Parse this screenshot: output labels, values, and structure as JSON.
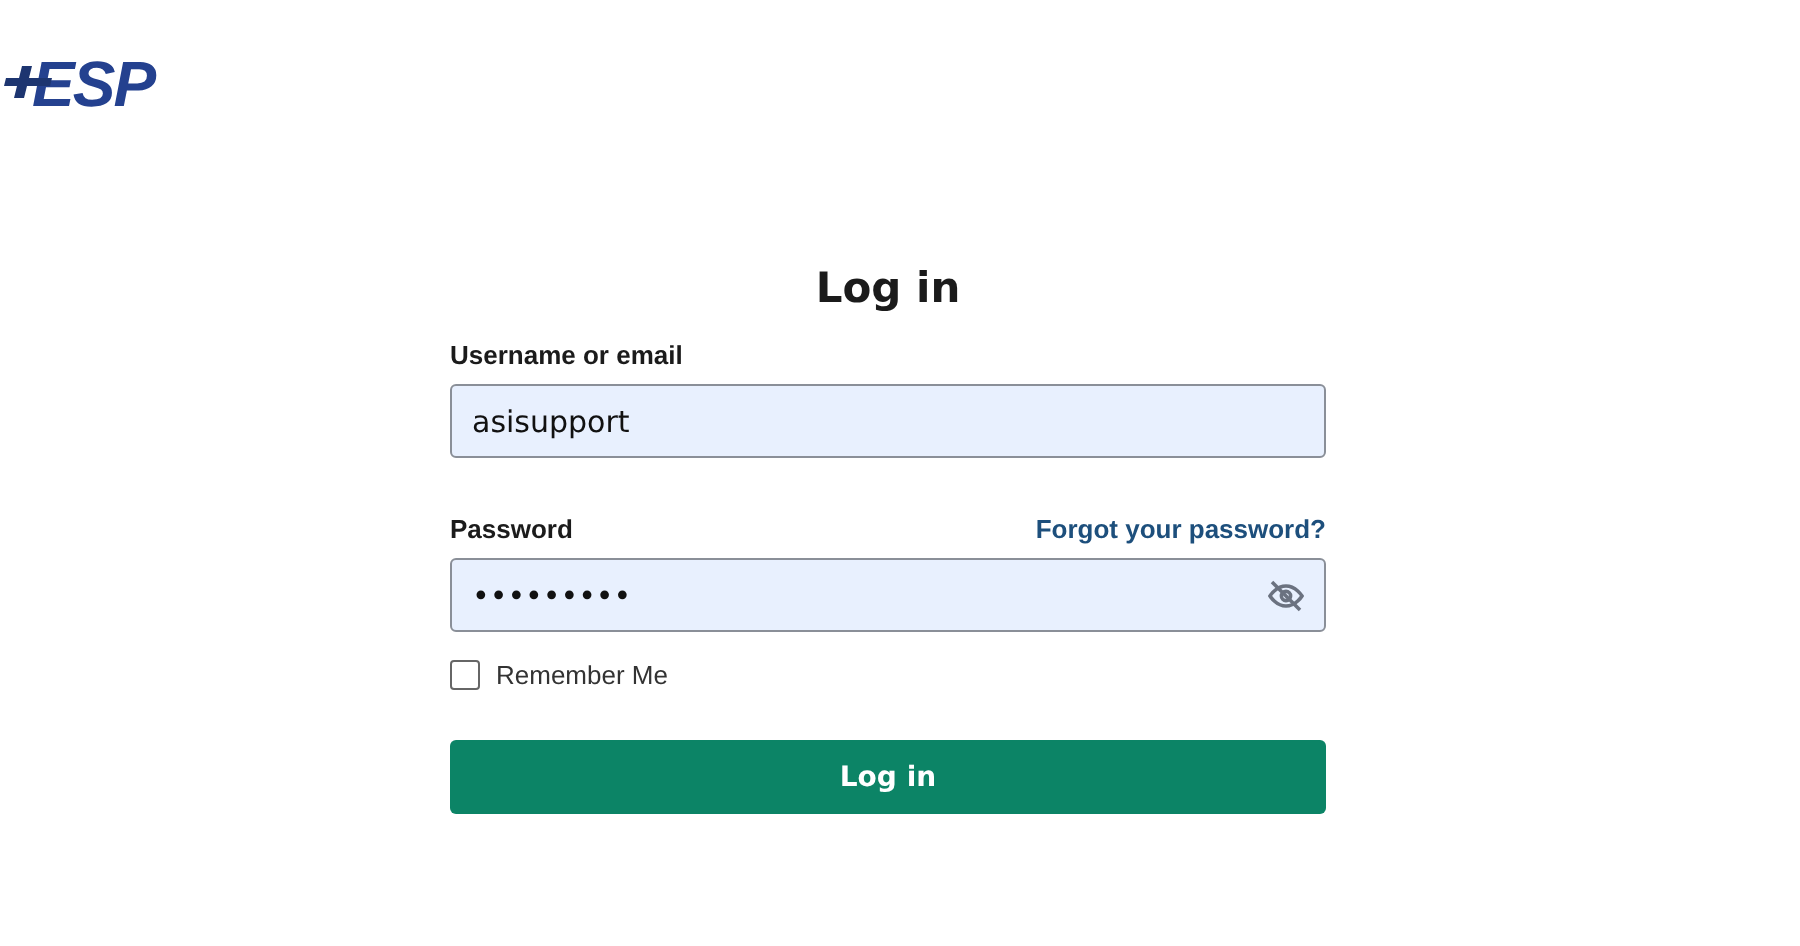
{
  "logo": {
    "text": "ESP"
  },
  "title": "Log in",
  "username": {
    "label": "Username or email",
    "value": "asisupport"
  },
  "password": {
    "label": "Password",
    "forgot_link": "Forgot your password?",
    "value": "•••••••••",
    "visibility_hidden": true
  },
  "remember": {
    "label": "Remember Me",
    "checked": false
  },
  "submit": "Log in"
}
